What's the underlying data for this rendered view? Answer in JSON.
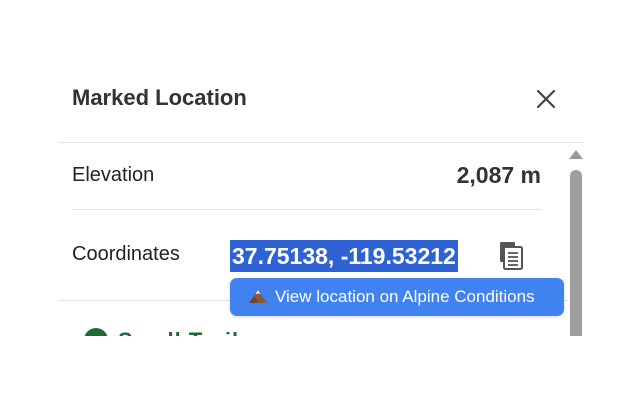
{
  "panel": {
    "title": "Marked Location",
    "close_icon": "close-icon",
    "rows": {
      "elevation": {
        "label": "Elevation",
        "value": "2,087 m"
      },
      "coordinates": {
        "label": "Coordinates",
        "value": "37.75138, -119.53212",
        "selected": true,
        "copy_icon": "copy-icon"
      }
    },
    "partial_row_text": "Small Trail"
  },
  "tooltip": {
    "icon": "mountain-icon",
    "text": "View location on Alpine Conditions"
  },
  "colors": {
    "selection": "#2f63d4",
    "tooltip_bg": "#3f82f0",
    "accent_green": "#1e6a33"
  }
}
